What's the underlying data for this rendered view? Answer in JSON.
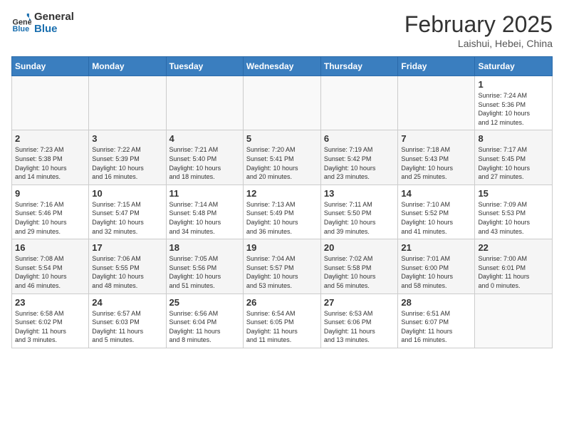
{
  "header": {
    "logo_line1": "General",
    "logo_line2": "Blue",
    "month_year": "February 2025",
    "location": "Laishui, Hebei, China"
  },
  "weekdays": [
    "Sunday",
    "Monday",
    "Tuesday",
    "Wednesday",
    "Thursday",
    "Friday",
    "Saturday"
  ],
  "weeks": [
    [
      {
        "day": "",
        "info": ""
      },
      {
        "day": "",
        "info": ""
      },
      {
        "day": "",
        "info": ""
      },
      {
        "day": "",
        "info": ""
      },
      {
        "day": "",
        "info": ""
      },
      {
        "day": "",
        "info": ""
      },
      {
        "day": "1",
        "info": "Sunrise: 7:24 AM\nSunset: 5:36 PM\nDaylight: 10 hours\nand 12 minutes."
      }
    ],
    [
      {
        "day": "2",
        "info": "Sunrise: 7:23 AM\nSunset: 5:38 PM\nDaylight: 10 hours\nand 14 minutes."
      },
      {
        "day": "3",
        "info": "Sunrise: 7:22 AM\nSunset: 5:39 PM\nDaylight: 10 hours\nand 16 minutes."
      },
      {
        "day": "4",
        "info": "Sunrise: 7:21 AM\nSunset: 5:40 PM\nDaylight: 10 hours\nand 18 minutes."
      },
      {
        "day": "5",
        "info": "Sunrise: 7:20 AM\nSunset: 5:41 PM\nDaylight: 10 hours\nand 20 minutes."
      },
      {
        "day": "6",
        "info": "Sunrise: 7:19 AM\nSunset: 5:42 PM\nDaylight: 10 hours\nand 23 minutes."
      },
      {
        "day": "7",
        "info": "Sunrise: 7:18 AM\nSunset: 5:43 PM\nDaylight: 10 hours\nand 25 minutes."
      },
      {
        "day": "8",
        "info": "Sunrise: 7:17 AM\nSunset: 5:45 PM\nDaylight: 10 hours\nand 27 minutes."
      }
    ],
    [
      {
        "day": "9",
        "info": "Sunrise: 7:16 AM\nSunset: 5:46 PM\nDaylight: 10 hours\nand 29 minutes."
      },
      {
        "day": "10",
        "info": "Sunrise: 7:15 AM\nSunset: 5:47 PM\nDaylight: 10 hours\nand 32 minutes."
      },
      {
        "day": "11",
        "info": "Sunrise: 7:14 AM\nSunset: 5:48 PM\nDaylight: 10 hours\nand 34 minutes."
      },
      {
        "day": "12",
        "info": "Sunrise: 7:13 AM\nSunset: 5:49 PM\nDaylight: 10 hours\nand 36 minutes."
      },
      {
        "day": "13",
        "info": "Sunrise: 7:11 AM\nSunset: 5:50 PM\nDaylight: 10 hours\nand 39 minutes."
      },
      {
        "day": "14",
        "info": "Sunrise: 7:10 AM\nSunset: 5:52 PM\nDaylight: 10 hours\nand 41 minutes."
      },
      {
        "day": "15",
        "info": "Sunrise: 7:09 AM\nSunset: 5:53 PM\nDaylight: 10 hours\nand 43 minutes."
      }
    ],
    [
      {
        "day": "16",
        "info": "Sunrise: 7:08 AM\nSunset: 5:54 PM\nDaylight: 10 hours\nand 46 minutes."
      },
      {
        "day": "17",
        "info": "Sunrise: 7:06 AM\nSunset: 5:55 PM\nDaylight: 10 hours\nand 48 minutes."
      },
      {
        "day": "18",
        "info": "Sunrise: 7:05 AM\nSunset: 5:56 PM\nDaylight: 10 hours\nand 51 minutes."
      },
      {
        "day": "19",
        "info": "Sunrise: 7:04 AM\nSunset: 5:57 PM\nDaylight: 10 hours\nand 53 minutes."
      },
      {
        "day": "20",
        "info": "Sunrise: 7:02 AM\nSunset: 5:58 PM\nDaylight: 10 hours\nand 56 minutes."
      },
      {
        "day": "21",
        "info": "Sunrise: 7:01 AM\nSunset: 6:00 PM\nDaylight: 10 hours\nand 58 minutes."
      },
      {
        "day": "22",
        "info": "Sunrise: 7:00 AM\nSunset: 6:01 PM\nDaylight: 11 hours\nand 0 minutes."
      }
    ],
    [
      {
        "day": "23",
        "info": "Sunrise: 6:58 AM\nSunset: 6:02 PM\nDaylight: 11 hours\nand 3 minutes."
      },
      {
        "day": "24",
        "info": "Sunrise: 6:57 AM\nSunset: 6:03 PM\nDaylight: 11 hours\nand 5 minutes."
      },
      {
        "day": "25",
        "info": "Sunrise: 6:56 AM\nSunset: 6:04 PM\nDaylight: 11 hours\nand 8 minutes."
      },
      {
        "day": "26",
        "info": "Sunrise: 6:54 AM\nSunset: 6:05 PM\nDaylight: 11 hours\nand 11 minutes."
      },
      {
        "day": "27",
        "info": "Sunrise: 6:53 AM\nSunset: 6:06 PM\nDaylight: 11 hours\nand 13 minutes."
      },
      {
        "day": "28",
        "info": "Sunrise: 6:51 AM\nSunset: 6:07 PM\nDaylight: 11 hours\nand 16 minutes."
      },
      {
        "day": "",
        "info": ""
      }
    ]
  ]
}
